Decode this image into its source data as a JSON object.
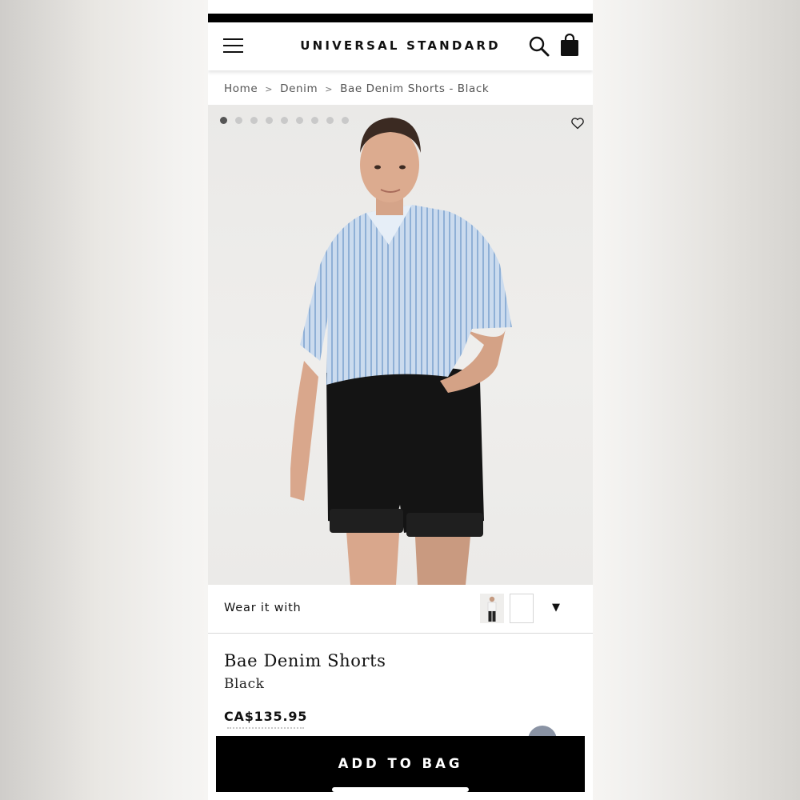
{
  "header": {
    "logo": "UNIVERSAL STANDARD",
    "menu_icon": "hamburger-menu-icon",
    "search_icon": "search-icon",
    "bag_icon": "shopping-bag-icon"
  },
  "breadcrumb": {
    "items": [
      "Home",
      "Denim",
      "Bae Denim Shorts - Black"
    ],
    "separator": ">"
  },
  "gallery": {
    "image_count": 9,
    "active_index": 0,
    "favorite_icon": "heart-icon"
  },
  "wear_it_with": {
    "label": "Wear it with",
    "caret": "▼"
  },
  "product": {
    "name": "Bae Denim Shorts",
    "color": "Black",
    "price": "CA$135.95"
  },
  "cta": {
    "add_to_bag": "ADD TO BAG"
  },
  "colors": {
    "primary": "#000000",
    "background": "#ffffff",
    "shirt": "#b9cde3",
    "shorts": "#141414"
  }
}
